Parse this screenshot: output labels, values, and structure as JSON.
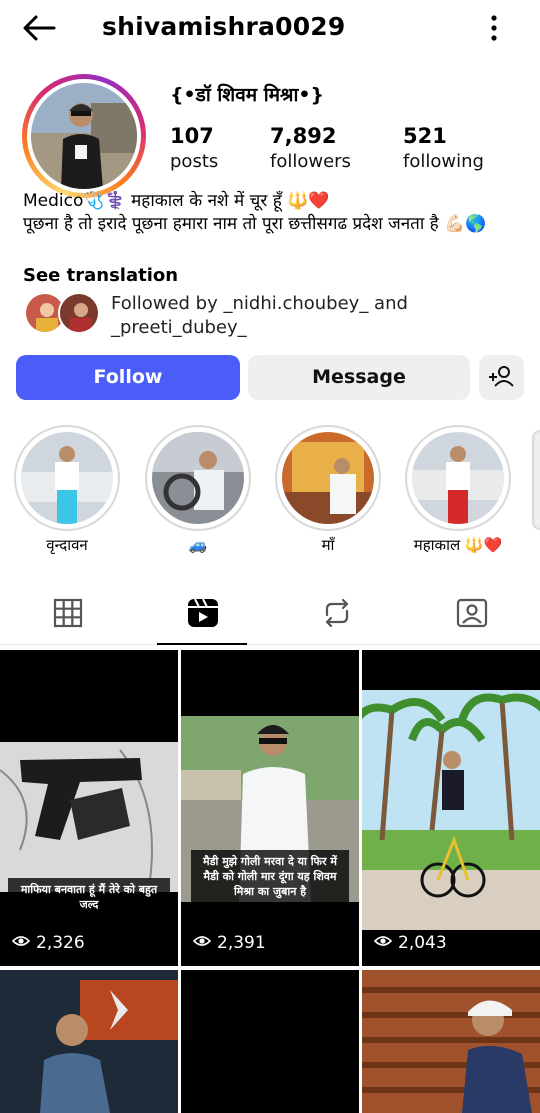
{
  "header": {
    "username": "shivamishra0029"
  },
  "profile": {
    "display_name": "{•डॉ शिवम मिश्रा•}",
    "stats": [
      {
        "value": "107",
        "label": "posts"
      },
      {
        "value": "7,892",
        "label": "followers"
      },
      {
        "value": "521",
        "label": "following"
      }
    ],
    "bio_line1": "Medico🩺⚕️  महाकाल के नशे में चूर हूँ 🔱❤️",
    "bio_line2": "पूछना है तो इरादे पूछना हमारा नाम तो पूरा छत्तीसगढ प्रदेश जनता है 💪🏻🌎",
    "see_translation": "See translation",
    "followed_by": "Followed by _nidhi.choubey_ and _preeti_dubey_"
  },
  "actions": {
    "follow": "Follow",
    "message": "Message"
  },
  "highlights": [
    {
      "label": "वृन्दावन"
    },
    {
      "label": "🚙"
    },
    {
      "label": "माँ"
    },
    {
      "label": "महाकाल 🔱❤️"
    }
  ],
  "tabs": [
    "grid-icon",
    "reels-icon",
    "reposts-icon",
    "tagged-icon"
  ],
  "posts": [
    {
      "views": "2,326",
      "caption": "माफिया बनवाता हूं मैं तेरे को बहुत जल्द"
    },
    {
      "views": "2,391",
      "caption": "मैडी मुझे गोली मरवा दे या फिर में मैडी को गोली मार दूंगा यह शिवम मिश्रा का जुबान है"
    },
    {
      "views": "2,043",
      "caption": ""
    }
  ],
  "colors": {
    "follow_button": "#4a5df9",
    "secondary_button": "#efefef"
  }
}
